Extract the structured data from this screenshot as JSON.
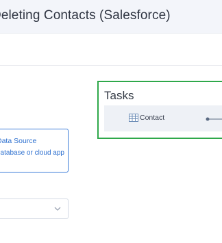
{
  "header": {
    "title": "Deleting Contacts (Salesforce)"
  },
  "source_card": {
    "title": "Data Source",
    "description": "database or cloud app"
  },
  "select": {
    "value": ""
  },
  "tasks": {
    "title": "Tasks",
    "items": [
      {
        "label": "Contact",
        "icon": "table-icon"
      }
    ]
  },
  "colors": {
    "highlight": "#2ea84a",
    "accent": "#2c6fcf",
    "header_bg": "#f3f5fa",
    "task_row_bg": "#eef1f6"
  }
}
